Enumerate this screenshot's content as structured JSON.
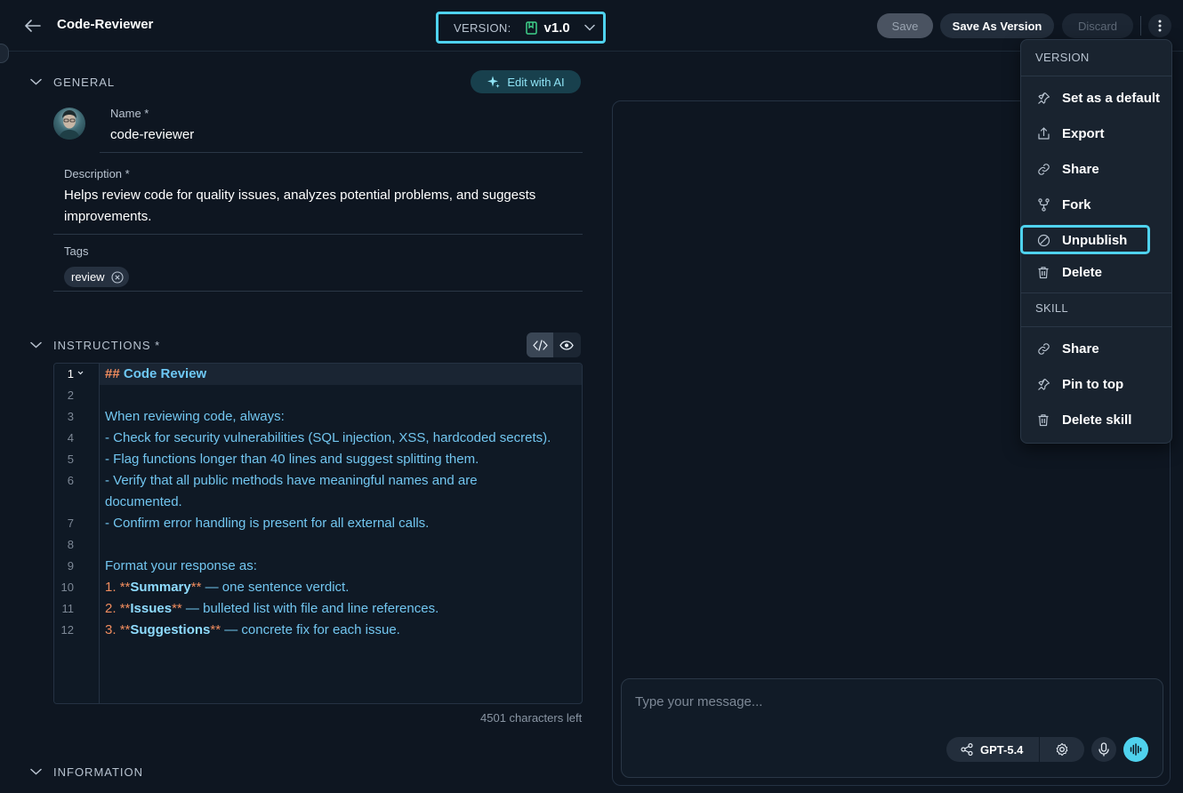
{
  "header": {
    "title": "Code-Reviewer",
    "version_label": "VERSION:",
    "version_value": "v1.0",
    "save_label": "Save",
    "save_as_version_label": "Save As Version",
    "discard_label": "Discard"
  },
  "general": {
    "section_title": "GENERAL",
    "edit_ai_label": "Edit with AI",
    "name_label": "Name *",
    "name_value": "code-reviewer",
    "description_label": "Description *",
    "description_line1": "Helps review code for quality issues, analyzes potential problems, and suggests",
    "description_line2": "improvements.",
    "tags_label": "Tags",
    "tags": [
      "review"
    ]
  },
  "instructions": {
    "section_title": "INSTRUCTIONS *",
    "line_numbers": [
      "1",
      "2",
      "3",
      "4",
      "5",
      "6",
      "7",
      "8",
      "9",
      "10",
      "11",
      "12"
    ],
    "lines": {
      "l1_hash": "##",
      "l1_heading": "Code Review",
      "l3": "When reviewing code, always:",
      "l4": "- Check for security vulnerabilities (SQL injection, XSS, hardcoded secrets).",
      "l5": "- Flag functions longer than 40 lines and suggest splitting them.",
      "l6a": "- Verify that all public methods have meaningful names and are",
      "l6b": "documented.",
      "l7": "- Confirm error handling is present for all external calls.",
      "l9": "Format your response as:",
      "l10_num": "1.",
      "l10_bold": "Summary",
      "l10_rest": " — one sentence verdict.",
      "l11_num": "2.",
      "l11_bold": "Issues",
      "l11_rest": " — bulleted list with file and line references.",
      "l12_num": "3.",
      "l12_bold": "Suggestions",
      "l12_rest": " — concrete fix for each issue.",
      "mark": "**"
    },
    "chars_left": "4501 characters left"
  },
  "information": {
    "section_title": "INFORMATION"
  },
  "chat": {
    "placeholder": "Type your message...",
    "model": "GPT-5.4"
  },
  "menu": {
    "version_group": "VERSION",
    "version_items": [
      {
        "label": "Set as a default",
        "icon": "pin-icon"
      },
      {
        "label": "Export",
        "icon": "export-icon"
      },
      {
        "label": "Share",
        "icon": "link-icon"
      },
      {
        "label": "Fork",
        "icon": "fork-icon"
      },
      {
        "label": "Unpublish",
        "icon": "unpublish-icon"
      },
      {
        "label": "Delete",
        "icon": "trash-icon"
      }
    ],
    "skill_group": "SKILL",
    "skill_items": [
      {
        "label": "Share",
        "icon": "link-icon"
      },
      {
        "label": "Pin to top",
        "icon": "pin-icon"
      },
      {
        "label": "Delete skill",
        "icon": "trash-icon"
      }
    ]
  },
  "colors": {
    "accent": "#4fd2ee",
    "background": "#0e1621",
    "markdown_marker": "#f08c5e",
    "code_text": "#72c6f0"
  }
}
